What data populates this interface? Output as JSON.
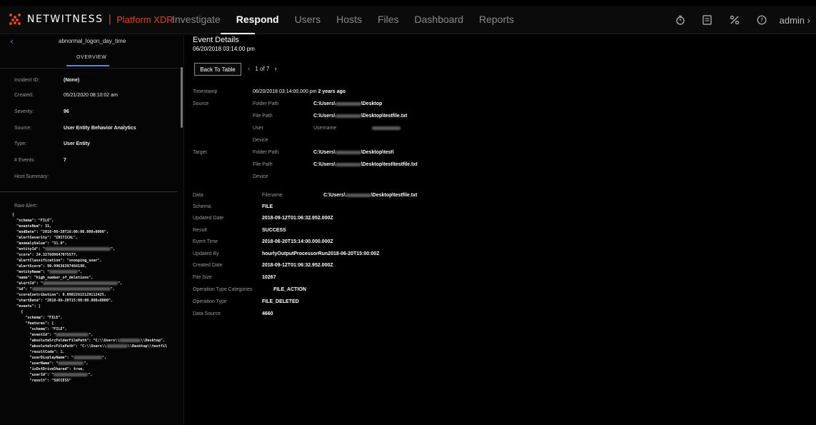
{
  "header": {
    "brand": "NETWITNESS",
    "product": "Platform XDR",
    "nav": [
      "Investigate",
      "Respond",
      "Users",
      "Hosts",
      "Files",
      "Dashboard",
      "Reports"
    ],
    "active_nav": "Respond",
    "user": "admin",
    "icons": [
      "timer-icon",
      "notes-icon",
      "tools-icon",
      "help-icon"
    ]
  },
  "incident": {
    "name": "abnormal_logon_day_time",
    "tab": "OVERVIEW",
    "fields": [
      {
        "label": "Incident ID:",
        "value": "(None)"
      },
      {
        "label": "Created:",
        "value": "05/21/2020 08:10:02 am"
      },
      {
        "label": "Severity:",
        "value": "96"
      },
      {
        "label": "Source:",
        "value": "User Entity Behavior Analytics"
      },
      {
        "label": "Type:",
        "value": "User Entity"
      },
      {
        "label": "# Events:",
        "value": "7"
      },
      {
        "label": "Host Summary:",
        "value": ""
      }
    ],
    "raw_label": "Raw Alert:"
  },
  "raw_alert": {
    "line01": "{",
    "line02": "  \"schema\": \"FILE\",",
    "line03": "  \"eventsNum\": 31,",
    "line04": "  \"endDate\": \"2018-06-20T16:00:00.000+0000\",",
    "line05": "  \"alertSeverity\": \"CRITICAL\",",
    "line06": "  \"anomalyValue\": \"31.0\",",
    "line07a": "  \"entityId\": \"",
    "line07b": "\",",
    "line08": "  \"score\": 24.327689647075577,",
    "line09": "  \"alertClassification\": \"snooping_user\",",
    "line10": "  \"alertScore\": 99.99636297464198,",
    "line11a": "  \"entityName\": \"",
    "line11b": "\",",
    "line12": "  \"name\": \"high_number_of_deletions\",",
    "line13a": "  \"alertId\": \"",
    "line13b": "\",",
    "line14a": "  \"id\": \"",
    "line14b": "\",",
    "line15": "  \"scoreContribution\": 0.09022615129112425,",
    "line16": "  \"startDate\": \"2018-06-20T15:00:00.000+0000\",",
    "line17": "  \"events\": [",
    "line18": "    {",
    "line19": "      \"schema\": \"FILE\",",
    "line20": "      \"features\": {",
    "line21": "        \"schema\": \"FILE\",",
    "line22a": "        \"eventId\": \"",
    "line22b": "\",",
    "line23a": "        \"absoluteSrcFolderFilePath\": \"C:\\\\Users\\\\",
    "line23b": "\\\\Desktop\",",
    "line24a": "        \"absoluteSrcFilePath\": \"C:\\\\Users\\\\",
    "line24b": "\\\\Desktop\\\\testfil",
    "line25": "        \"resultCode\": 1,",
    "line26a": "        \"userDisplayName\": \"",
    "line26b": "\",",
    "line27a": "        \"userName\": \"",
    "line27b": "\",",
    "line28": "        \"isDstDriveShared\": true,",
    "line29a": "        \"userId\": \"",
    "line29b": "\",",
    "line30": "        \"result\": \"SUCCESS\""
  },
  "event": {
    "title": "Event Details",
    "date": "06/20/2018 03:14:00 pm",
    "back_label": "Back To Table",
    "pager": "1 of 7",
    "timestamp_label": "Timestamp",
    "timestamp_value": "06/20/2018 03:14:00.000 pm",
    "timestamp_ago": "2 years ago",
    "source_label": "Source",
    "target_label": "Target",
    "data_label": "Data",
    "folder_path_label": "Folder Path",
    "file_path_label": "File Path",
    "user_label": "User",
    "device_label": "Device",
    "username_label": "Username",
    "filename_label": "Filename",
    "path_prefix": "C:\\Users\\",
    "src_folder_suffix": "\\Desktop",
    "src_file_suffix": "\\Desktop\\testfile.txt",
    "tgt_folder_suffix": "\\Desktop\\test\\",
    "tgt_file_suffix": "\\Desktop\\test\\testfile.txt",
    "data_file_suffix": "\\Desktop\\testfile.txt",
    "details": [
      {
        "label": "Schema",
        "value": "FILE"
      },
      {
        "label": "Updated Date",
        "value": "2018-09-12T01:06:32.952.000Z"
      },
      {
        "label": "Result",
        "value": "SUCCESS"
      },
      {
        "label": "Event Time",
        "value": "2018-06-20T15:14:00.000.000Z"
      },
      {
        "label": "Updated By",
        "value": "hourlyOutputProcessorRun2018-06-20T15:00:00Z"
      },
      {
        "label": "Created Date",
        "value": "2018-09-12T01:06:32.952.000Z"
      },
      {
        "label": "File Size",
        "value": "10267"
      },
      {
        "label": "Operation Type Categories",
        "value": "FILE_ACTION"
      },
      {
        "label": "Operation Type",
        "value": "FILE_DELETED"
      },
      {
        "label": "Data Source",
        "value": "4660"
      }
    ]
  }
}
